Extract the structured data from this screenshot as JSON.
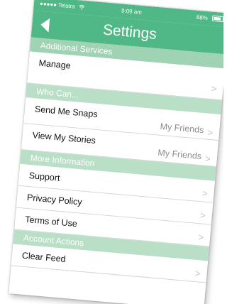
{
  "status_bar": {
    "carrier": "●●●●● Telstra",
    "wifi_icon": "wifi-icon",
    "time": "9:09 am",
    "battery": "88%"
  },
  "nav": {
    "back_icon": "back-arrow-icon",
    "title": "Settings"
  },
  "sections": {
    "additional_services": {
      "header": "Additional Services",
      "manage": "Manage"
    },
    "who_can": {
      "header": "Who Can...",
      "send_me_snaps": "Send Me Snaps",
      "send_me_snaps_value": "My Friends",
      "view_my_stories": "View My Stories",
      "view_my_stories_value": "My Friends"
    },
    "more_information": {
      "header": "More Information",
      "support": "Support",
      "privacy_policy": "Privacy Policy",
      "terms_of_use": "Terms of Use"
    },
    "account_actions": {
      "header": "Account Actions",
      "clear_feed": "Clear Feed"
    }
  },
  "chevron": ">",
  "colors": {
    "nav_green": "#50b886",
    "section_header": "#b9dfc7",
    "section_text": "#ffffff",
    "row_text": "#111111",
    "value_text": "#8e8e8e"
  }
}
